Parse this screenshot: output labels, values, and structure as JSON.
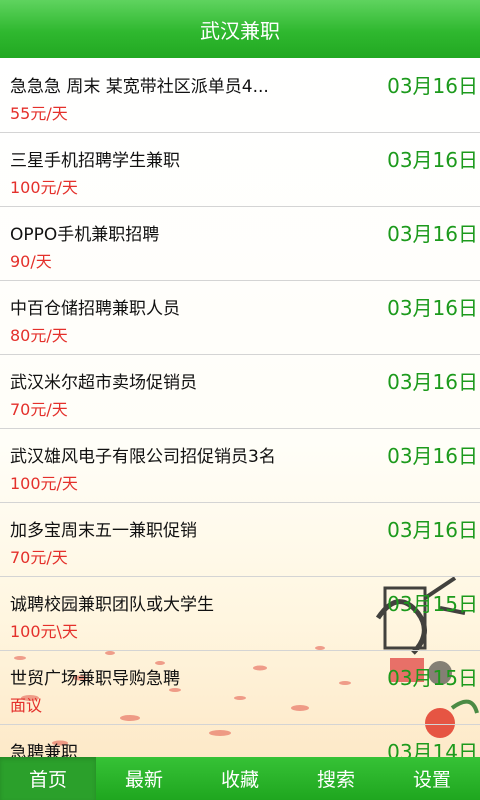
{
  "header": {
    "title": "武汉兼职"
  },
  "jobs": [
    {
      "title": "急急急 周末 某宽带社区派单员4...",
      "pay": "55元/天",
      "date": "03月16日"
    },
    {
      "title": "三星手机招聘学生兼职",
      "pay": "100元/天",
      "date": "03月16日"
    },
    {
      "title": "OPPO手机兼职招聘",
      "pay": "90/天",
      "date": "03月16日"
    },
    {
      "title": "中百仓储招聘兼职人员",
      "pay": "80元/天",
      "date": "03月16日"
    },
    {
      "title": "武汉米尔超市卖场促销员",
      "pay": "70元/天",
      "date": "03月16日"
    },
    {
      "title": "武汉雄风电子有限公司招促销员3名",
      "pay": "100元/天",
      "date": "03月16日"
    },
    {
      "title": "加多宝周末五一兼职促销",
      "pay": "70元/天",
      "date": "03月16日"
    },
    {
      "title": "诚聘校园兼职团队或大学生",
      "pay": "100元\\天",
      "date": "03月15日"
    },
    {
      "title": "世贸广场兼职导购急聘",
      "pay": "面议",
      "date": "03月15日"
    },
    {
      "title": "急聘兼职",
      "pay": "",
      "date": "03月14日"
    }
  ],
  "tabs": [
    {
      "label": "首页"
    },
    {
      "label": "最新"
    },
    {
      "label": "收藏"
    },
    {
      "label": "搜索"
    },
    {
      "label": "设置"
    }
  ],
  "colors": {
    "header_green": "#2fb82f",
    "date_green": "#1c9a1c",
    "pay_red": "#e4302b"
  }
}
